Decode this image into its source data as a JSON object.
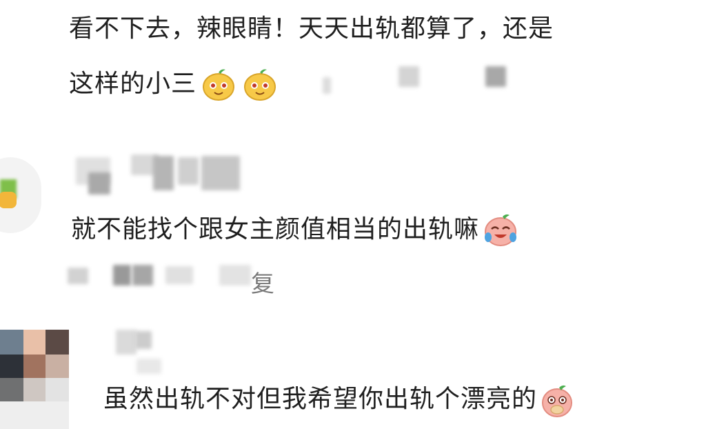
{
  "comments": [
    {
      "text_line1": "看不下去，辣眼睛！天天出轨都算了，还是",
      "text_line2": "这样的小三",
      "emoji": [
        "smirk-face-emoji",
        "smirk-face-emoji"
      ]
    },
    {
      "text": "就不能找个跟女主颜值相当的出轨嘛",
      "emoji": [
        "laugh-cry-emoji"
      ],
      "reply_label": "复"
    },
    {
      "text": "虽然出轨不对但我希望你出轨个漂亮的",
      "emoji": [
        "cover-mouth-emoji"
      ]
    }
  ],
  "colors": {
    "text": "#1f1f1f",
    "meta": "#7a7a7a",
    "blur": "#bdbdbd",
    "emoji_yellow": "#f7c948",
    "emoji_pink": "#f4a7a0"
  }
}
